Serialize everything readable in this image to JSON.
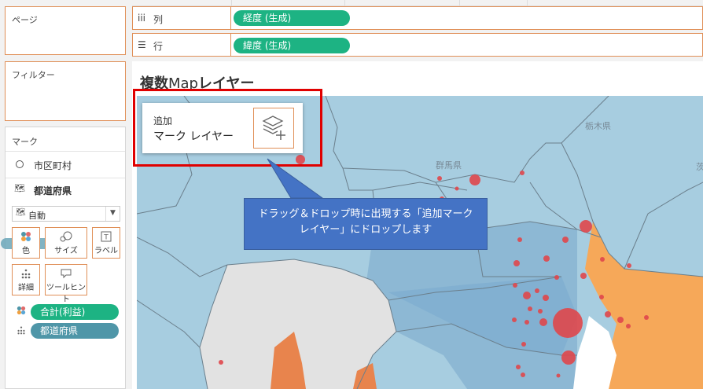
{
  "pages_panel": {
    "title": "ページ"
  },
  "filters_panel": {
    "title": "フィルター"
  },
  "marks_panel": {
    "title": "マーク",
    "layers": [
      {
        "icon": "circle-icon",
        "label": "市区町村"
      },
      {
        "icon": "map-icon",
        "label": "都道府県"
      }
    ],
    "mark_type": "自動",
    "buttons": [
      {
        "name": "color",
        "label": "色",
        "icon": "color-dots-icon"
      },
      {
        "name": "size",
        "label": "サイズ",
        "icon": "size-icon"
      },
      {
        "name": "label",
        "label": "ラベル",
        "icon": "text-label-icon"
      },
      {
        "name": "detail",
        "label": "詳細",
        "icon": "detail-dots-icon"
      },
      {
        "name": "tooltip",
        "label": "ツールヒント",
        "icon": "tooltip-icon"
      }
    ],
    "fields": [
      {
        "icon": "color-dots-icon",
        "label": "合計(利益)",
        "color": "#1db383"
      },
      {
        "icon": "detail-dots-icon",
        "label": "都道府県",
        "color": "#4f96a8"
      }
    ]
  },
  "shelves": {
    "columns": {
      "icon": "iii",
      "label": "列",
      "pill": "経度 (生成)"
    },
    "rows": {
      "icon": "☰",
      "label": "行",
      "pill": "緯度 (生成)"
    }
  },
  "viz": {
    "title_bold_1": "複数",
    "title_normal": "Map",
    "title_bold_2": "レイヤー",
    "add_layer": {
      "line1": "追加",
      "line2": "マーク レイヤー"
    },
    "callout": "ドラッグ＆ドロップ時に出現する「追加マークレイヤー」にドロップします",
    "map_labels": [
      "群馬県",
      "栃木県",
      "茨"
    ]
  },
  "colors": {
    "accent_border": "#e08f57",
    "pill_green": "#1db383",
    "pill_teal": "#4f96a8",
    "map_water": "#a7cde0",
    "map_orange": "#f6a859",
    "dot_red": "#e0474c",
    "callout_blue": "#4473c5",
    "highlight_red": "#e00000"
  }
}
